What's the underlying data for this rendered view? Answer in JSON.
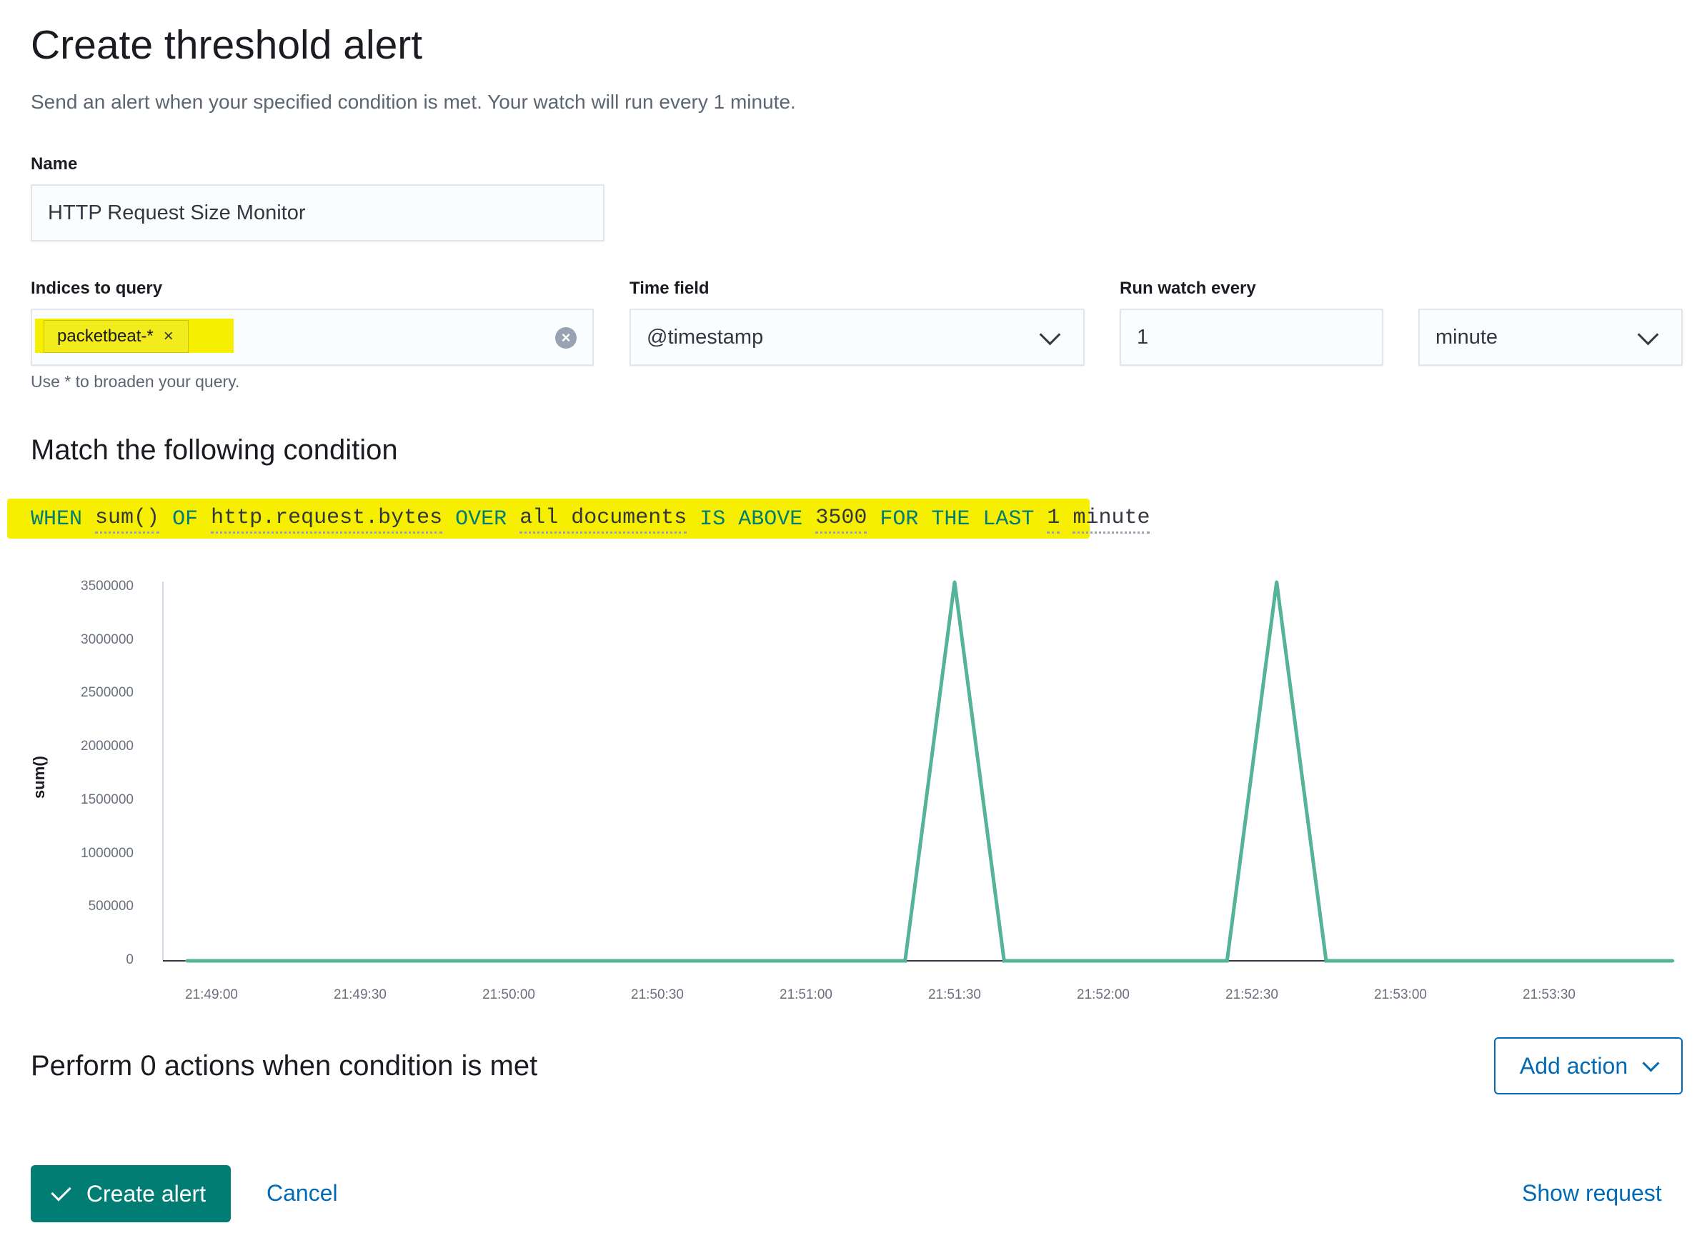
{
  "page": {
    "title": "Create threshold alert",
    "subtitle": "Send an alert when your specified condition is met. Your watch will run every 1 minute."
  },
  "name_field": {
    "label": "Name",
    "value": "HTTP Request Size Monitor"
  },
  "indices": {
    "label": "Indices to query",
    "chip": "packetbeat-*",
    "chip_remove": "×",
    "clear": "×",
    "help": "Use * to broaden your query."
  },
  "time_field": {
    "label": "Time field",
    "value": "@timestamp"
  },
  "run_every": {
    "label": "Run watch every",
    "value": "1",
    "unit": "minute"
  },
  "condition": {
    "title": "Match the following condition",
    "expression": {
      "when": "WHEN",
      "agg": "sum()",
      "of": "OF",
      "field": "http.request.bytes",
      "over": "OVER",
      "group": "all documents",
      "is": "IS ABOVE",
      "threshold": "3500",
      "for": "FOR THE LAST",
      "window_size": "1",
      "window_unit": "minute"
    }
  },
  "chart_data": {
    "type": "line",
    "ylabel": "sum()",
    "ylim": [
      0,
      3500000
    ],
    "yticks": [
      "3500000",
      "3000000",
      "2500000",
      "2000000",
      "1500000",
      "1000000",
      "500000",
      "0"
    ],
    "xticks": [
      "21:49:00",
      "21:49:30",
      "21:50:00",
      "21:50:30",
      "21:51:00",
      "21:51:30",
      "21:52:00",
      "21:52:30",
      "21:53:00",
      "21:53:30"
    ],
    "x": [
      "21:48:55",
      "21:51:20",
      "21:51:30",
      "21:51:40",
      "21:52:25",
      "21:52:35",
      "21:52:45",
      "21:53:55"
    ],
    "values": [
      0,
      0,
      3550000,
      0,
      0,
      3550000,
      0,
      0
    ],
    "color": "#54b399"
  },
  "actions": {
    "title": "Perform 0 actions when condition is met",
    "add_label": "Add action"
  },
  "footer": {
    "create_label": "Create alert",
    "cancel_label": "Cancel",
    "show_request_label": "Show request"
  },
  "colors": {
    "primary": "#017d73",
    "link": "#006bb4",
    "highlight": "#f6f000"
  }
}
